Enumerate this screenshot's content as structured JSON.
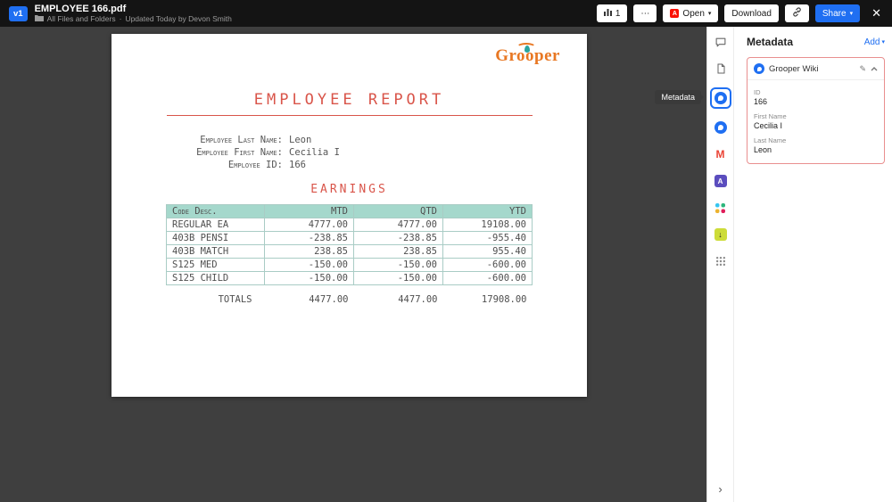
{
  "colors": {
    "accent": "#1f6ff2",
    "card-border": "#e98f8f",
    "table-head": "#a5d8cc",
    "table-border": "#a9ccc5",
    "doc-red": "#d9554a",
    "logo-orange": "#e87722"
  },
  "topbar": {
    "version_badge": "v1",
    "title": "EMPLOYEE 166.pdf",
    "breadcrumb": "All Files and Folders",
    "separator": "·",
    "updated_text": "Updated Today by Devon Smith",
    "version_count": "1",
    "open_label": "Open",
    "download_label": "Download",
    "share_label": "Share"
  },
  "document": {
    "logo_text": "Grooper",
    "title": "EMPLOYEE REPORT",
    "fields": [
      {
        "label": "Employee Last Name:",
        "value": "Leon"
      },
      {
        "label": "Employee First Name:",
        "value": "Cecilia I"
      },
      {
        "label": "Employee ID:",
        "value": "166"
      }
    ],
    "earnings_title": "EARNINGS",
    "table": {
      "headers": [
        "Code Desc.",
        "MTD",
        "QTD",
        "YTD"
      ],
      "rows": [
        [
          "REGULAR EA",
          "4777.00",
          "4777.00",
          "19108.00"
        ],
        [
          "403B PENSI",
          "-238.85",
          "-238.85",
          "-955.40"
        ],
        [
          "403B MATCH",
          "238.85",
          "238.85",
          "955.40"
        ],
        [
          "S125 MED",
          "-150.00",
          "-150.00",
          "-600.00"
        ],
        [
          "S125 CHILD",
          "-150.00",
          "-150.00",
          "-600.00"
        ]
      ],
      "totals_label": "TOTALS",
      "totals": [
        "4477.00",
        "4477.00",
        "17908.00"
      ]
    }
  },
  "tooltip": {
    "label": "Metadata"
  },
  "integration_sidebar": {
    "icons": [
      "comments-icon",
      "file-info-icon",
      "grooper-wiki-icon",
      "blue-app-icon",
      "gmail-icon",
      "adobe-acrobat-icon",
      "slack-icon",
      "download-app-icon",
      "more-apps-icon"
    ],
    "selected": "grooper-wiki-icon"
  },
  "metadata_panel": {
    "title": "Metadata",
    "add_label": "Add",
    "card": {
      "source": "Grooper Wiki",
      "fields": [
        {
          "label": "ID",
          "value": "166"
        },
        {
          "label": "First Name",
          "value": "Cecilia I"
        },
        {
          "label": "Last Name",
          "value": "Leon"
        }
      ]
    }
  }
}
